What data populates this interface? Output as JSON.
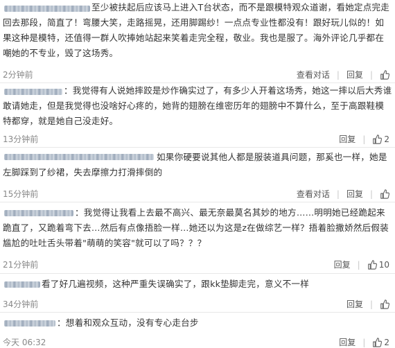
{
  "comments": [
    {
      "text": "至少被扶起后应该马上进入T台状态，而不是跟模特观众道谢，看她定点完走回去那段，简直了！弯腰大笑，走路摇晃，还用脚踢纱！一点点专业性都没有！跟好玩儿似的！如果这种是模特，还值得一群人吹捧她站起来笑着走完全程，敬业。我也是服了。海外评论几乎都在嘲她的不专业，毁了这场秀。",
      "time": "2分钟前",
      "view_thread": "查看对话",
      "reply": "回复",
      "likes": ""
    },
    {
      "text": "：我觉得有人说她摔跤是炒作确实过了，有多少人开着这场秀，她这一摔以后大秀谁敢请她走，但是我觉得也没啥好心疼的，她背的翅膀在维密历年的翅膀中不算什么，至于高跟鞋模特都穿，就是她自己没走好。",
      "time": "13分钟前",
      "view_thread": "",
      "reply": "回复",
      "likes": "2"
    },
    {
      "text": "如果你硬要说其他人都是服装道具问题，那奚也一样，她是左脚踩到了纱裙，失去摩擦力打滑摔倒的",
      "time": "15分钟前",
      "view_thread": "查看对话",
      "reply": "回复",
      "likes": ""
    },
    {
      "text": "：我觉得让我看上去最不高兴、最无奈最莫名其妙的地方……明明她已经跪起来跪直了，又跪着弯下去…然后有点像捂脸一样…她还以为这是z在做综艺一样？捂着脸撒娇然后假装尴尬的吐吐舌头带着\"萌萌的笑容\"就可以了吗？？？",
      "time": "21分钟前",
      "view_thread": "",
      "reply": "回复",
      "likes": "10"
    },
    {
      "text": "看了好几遍视频，这种严重失误确实了，跟kk垫脚走完，意义不一样",
      "time": "34分钟前",
      "view_thread": "",
      "reply": "回复",
      "likes": ""
    },
    {
      "text": "：想着和观众互动，没有专心走台步",
      "time": "今天 06:32",
      "view_thread": "",
      "reply": "回复",
      "likes": "2"
    }
  ],
  "icons": {
    "like": "thumbs-up-icon"
  },
  "colors": {
    "text": "#333333",
    "meta": "#888888",
    "divider": "#e8e8e8"
  }
}
